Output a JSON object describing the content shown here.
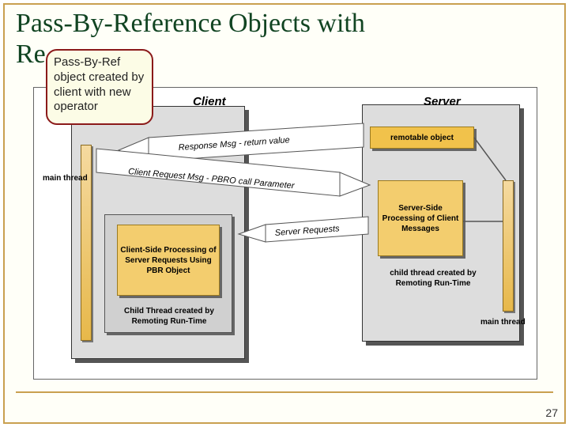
{
  "slide": {
    "title_line1": "Pass-By-Reference Objects with",
    "title_line2": "Re",
    "page_number": "27"
  },
  "callout": {
    "text": "Pass-By-Ref object created by client with new operator"
  },
  "labels": {
    "client": "Client",
    "server": "Server",
    "main_thread_left": "main thread",
    "main_thread_right": "main thread",
    "remotable_object": "remotable object",
    "client_side_panel": "Client-Side Processing of Server Requests Using PBR Object",
    "server_side_panel": "Server-Side Processing of Client Messages",
    "child_thread_client": "Child Thread created by Remoting Run-Time",
    "child_thread_server": "child thread  created by Remoting Run-Time",
    "response_arrow": "Response Msg - return value",
    "client_request_arrow": "Client Request Msg - PBRO call Parameter",
    "server_requests_arrow": "Server Requests"
  }
}
